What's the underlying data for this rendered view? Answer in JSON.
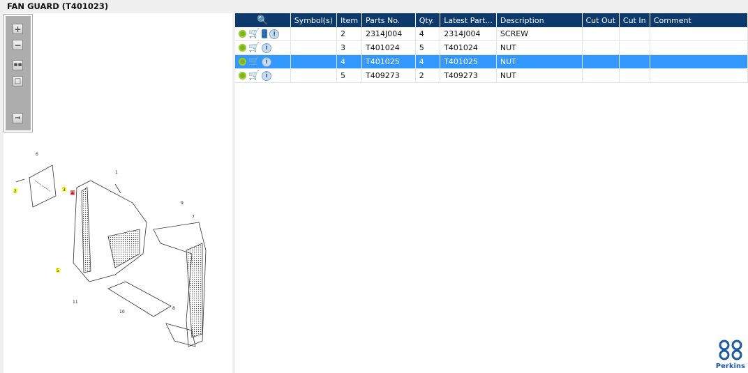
{
  "title": "FAN GUARD (T401023)",
  "toolbar": [
    "zoom-in",
    "zoom-out",
    "fit-all",
    "fit-window",
    "toggle-panel"
  ],
  "diagram": {
    "callouts": [
      "1",
      "2",
      "3",
      "4",
      "5",
      "6",
      "7",
      "8",
      "9",
      "10",
      "11"
    ],
    "highlighted": {
      "2": "#ffff33",
      "3": "#ffff33",
      "5": "#ffff33",
      "4": "#ff6666"
    }
  },
  "table": {
    "headers": [
      "Symbol(s)",
      "Item",
      "Parts No.",
      "Qty.",
      "Latest Part...",
      "Description",
      "Cut Out",
      "Cut In",
      "Comment"
    ],
    "rows": [
      {
        "book": true,
        "item": "2",
        "part": "2314J004",
        "qty": "4",
        "latest": "2314J004",
        "desc": "SCREW"
      },
      {
        "book": false,
        "item": "3",
        "part": "T401024",
        "qty": "5",
        "latest": "T401024",
        "desc": "NUT"
      },
      {
        "book": false,
        "item": "4",
        "part": "T401025",
        "qty": "4",
        "latest": "T401025",
        "desc": "NUT",
        "selected": true
      },
      {
        "book": false,
        "item": "5",
        "part": "T409273",
        "qty": "2",
        "latest": "T409273",
        "desc": "NUT"
      }
    ]
  },
  "logo": "Perkins"
}
